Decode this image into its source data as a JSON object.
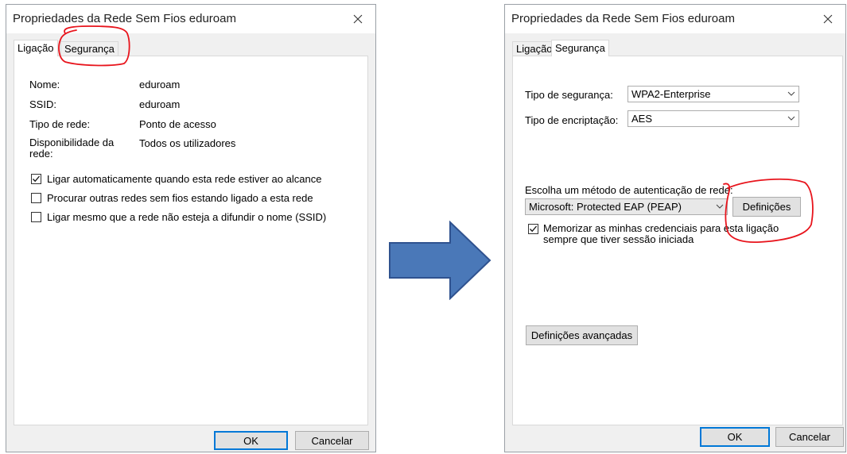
{
  "left_dialog": {
    "title": "Propriedades da Rede Sem Fios eduroam",
    "tabs": [
      "Ligação",
      "Segurança"
    ],
    "fields": [
      {
        "label": "Nome:",
        "value": "eduroam"
      },
      {
        "label": "SSID:",
        "value": "eduroam"
      },
      {
        "label": "Tipo de rede:",
        "value": "Ponto de acesso"
      },
      {
        "label": "Disponibilidade da rede:",
        "value": "Todos os utilizadores"
      }
    ],
    "checkboxes": [
      {
        "label": "Ligar automaticamente quando esta rede estiver ao alcance",
        "checked": true
      },
      {
        "label": "Procurar outras redes sem fios estando ligado a esta rede",
        "checked": false
      },
      {
        "label": "Ligar mesmo que a rede não esteja a difundir o nome (SSID)",
        "checked": false
      }
    ],
    "ok": "OK",
    "cancel": "Cancelar"
  },
  "right_dialog": {
    "title": "Propriedades da Rede Sem Fios eduroam",
    "tabs": [
      "Ligação",
      "Segurança"
    ],
    "security_type_label": "Tipo de segurança:",
    "security_type_value": "WPA2-Enterprise",
    "encryption_label": "Tipo de encriptação:",
    "encryption_value": "AES",
    "auth_method_label": "Escolha um método de autenticação de rede:",
    "auth_method_value": "Microsoft: Protected EAP (PEAP)",
    "settings_button": "Definições",
    "remember_label": "Memorizar as minhas credenciais para esta ligação sempre que tiver sessão iniciada",
    "remember_checked": true,
    "advanced_button": "Definições avançadas",
    "ok": "OK",
    "cancel": "Cancelar"
  },
  "colors": {
    "arrow_fill": "#4a78b8",
    "arrow_stroke": "#2f528f",
    "annotation": "#e8141c"
  }
}
